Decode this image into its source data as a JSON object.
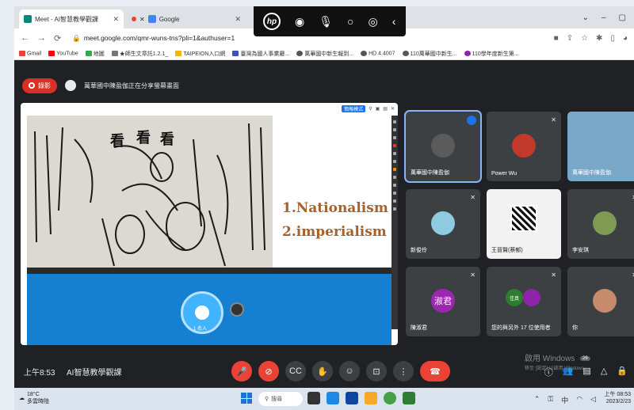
{
  "browser": {
    "tabs": [
      {
        "label": "Meet - AI智慧教學觀課",
        "active": true
      },
      {
        "label": "Google",
        "active": false
      },
      {
        "label": "",
        "active": false
      }
    ],
    "url": "meet.google.com/qmr-wuns-tns?pli=1&authuser=1",
    "bookmarks": [
      "Gmail",
      "YouTube",
      "地圖",
      "★師生文章託1.2.1_",
      "TAIPEION入口網",
      "臺灣為國人事業廳...",
      "萬華國中新生報到...",
      "HD 4.4007",
      "110萬華國中新生...",
      "110學年度新生第..."
    ],
    "window_controls": [
      "⌄",
      "–",
      "▢"
    ],
    "hp_toolbar": {
      "logo": "hp"
    }
  },
  "meet": {
    "record_label": "錄影",
    "presenter_text": "萬華國中陳盈伽正在分享螢幕畫面",
    "slide": {
      "items": [
        "1.Nationalism",
        "2.imperialism"
      ],
      "toolbar": {
        "badge": "簡報模式"
      }
    },
    "camera_label": "1 名人",
    "participants": [
      {
        "name": "萬華國中陳盈伽",
        "avatar": "",
        "speaking": true,
        "color": "#5b5b5b"
      },
      {
        "name": "Power Wu",
        "avatar": "",
        "speaking": false,
        "color": "#c0392b"
      },
      {
        "name": "萬華國中陳盈伽",
        "avatar": "",
        "speaking": false,
        "color": "#7aa8c8"
      },
      {
        "name": "新俊伶",
        "avatar": "",
        "speaking": false,
        "color": "#8fcbe0"
      },
      {
        "name": "王晉賢(蔡郁)",
        "avatar": "",
        "speaking": false,
        "color": "#f2f2f2"
      },
      {
        "name": "李安琪",
        "avatar": "",
        "speaking": false,
        "color": "#7f9a52"
      },
      {
        "name": "陳淑君",
        "avatar": "淑君",
        "speaking": false,
        "color": "#9c27b0"
      },
      {
        "name": "您的與另外 17 位使用者",
        "avatar": "佳真",
        "speaking": false,
        "color": "#2e7d32"
      },
      {
        "name": "你",
        "avatar": "",
        "speaking": false,
        "color": "#c58b6a"
      }
    ],
    "time": "上午8:53",
    "meeting_title": "AI智慧教學觀課",
    "people_count": "26",
    "activate_windows": {
      "title": "啟用 Windows",
      "sub": "移至 [設定] 以啟用 Windows。"
    }
  },
  "taskbar": {
    "weather_temp": "18°C",
    "weather_desc": "多雲時陰",
    "search": "搜尋",
    "clock_time": "上午 08:53",
    "clock_date": "2023/2/23"
  },
  "colors": {
    "meet_bg": "#202124",
    "record_red": "#d93025",
    "end_call": "#ea4335",
    "slide_text": "#a8612a"
  }
}
